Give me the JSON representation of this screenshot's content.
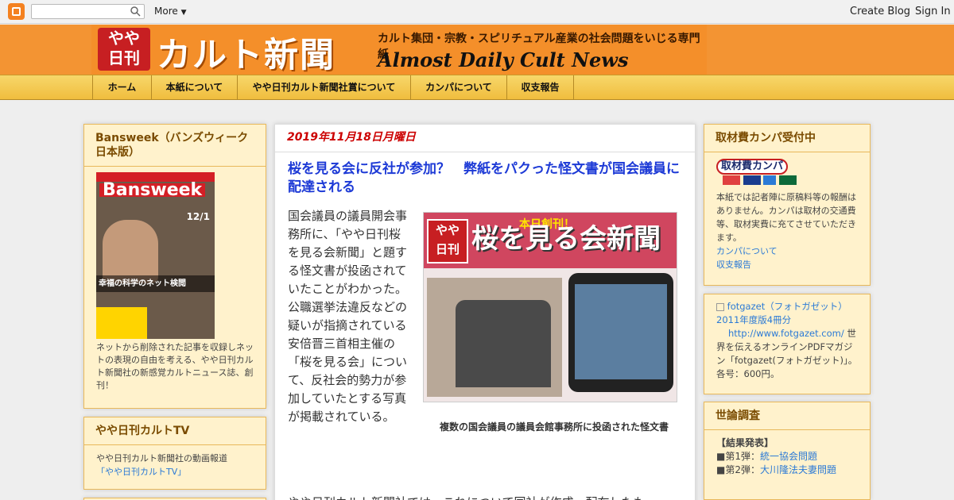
{
  "navbar": {
    "more_label": "More",
    "create_blog": "Create Blog",
    "sign_in": "Sign In"
  },
  "banner": {
    "badge_top": "やや",
    "badge_bottom": "日刊",
    "title": "カルト新聞",
    "tagline": "カルト集団・宗教・スピリチュアル産業の社会問題をいじる専門紙",
    "english": "Almost Daily Cult News"
  },
  "tabs": [
    "ホーム",
    "本紙について",
    "やや日刊カルト新聞社賞について",
    "カンパについて",
    "収支報告"
  ],
  "left_sidebar": {
    "bansweek_title": "Bansweek（バンズウィーク日本版）",
    "bansweek_cover_title": "Bansweek",
    "bansweek_cover_date": "12/1",
    "bansweek_cover_headline": "幸福の科学のネット検閲",
    "bansweek_desc": "ネットから削除された記事を収録しネットの表現の自由を考える、やや日刊カルト新聞社の新感覚カルトニュース誌、創刊！",
    "tv_title": "やや日刊カルトTV",
    "tv_desc": "やや日刊カルト新聞社の動画報道",
    "tv_link": "「やや日刊カルトTV」"
  },
  "post": {
    "date": "2019年11月18日月曜日",
    "title": "桜を見る会に反社が参加？　弊紙をパクった怪文書が国会議員に配達される",
    "body": "国会議員の議員開会事務所に、「やや日刊桜を見る会新聞」と題する怪文書が投函されていたことがわかった。公職選挙法違反などの疑いが指摘されている安倍晋三首相主催の「桜を見る会」について、反社会的勢力が参加していたとする写真が掲載されている。",
    "image_heading": "桜を見る会新聞",
    "image_badge_top": "やや",
    "image_badge_bottom": "日刊",
    "image_sub": "本日創刊！",
    "image_caption": "複数の国会議員の議員会館事務所に投函された怪文書",
    "next_line": "やや日刊カルト新聞社では、これについて同社が作成・配布したも"
  },
  "right_sidebar": {
    "kanpa_title": "取材費カンパ受付中",
    "kanpa_badge": "取材費カンパ",
    "kanpa_desc": "本紙では記者陣に原稿料等の報酬はありません。カンパは取材の交通費等、取材実費に充てさせていただきます。",
    "kanpa_link1": "カンパについて",
    "kanpa_link2": "収支報告",
    "fotgazet_link": "fotgazet（フォトガゼット）2011年度版4冊分",
    "fotgazet_url": "http://www.fotgazet.com/",
    "fotgazet_desc": "世界を伝えるオンラインPDFマガジン「fotgazet(フォトガゼット)」。各号：600円。",
    "poll_title": "世論調査",
    "poll_result": "【結果発表】",
    "poll1_prefix": "■第1弾：",
    "poll1_link": "統一協会問題",
    "poll2_prefix": "■第2弾：",
    "poll2_link": "大川隆法夫妻問題"
  },
  "colors": {
    "header_orange": "#f39433",
    "tab_gold": "#f0bd3e",
    "widget_bg": "#fff2cc",
    "post_title": "#1d3ad6",
    "date_red": "#cc0000"
  }
}
